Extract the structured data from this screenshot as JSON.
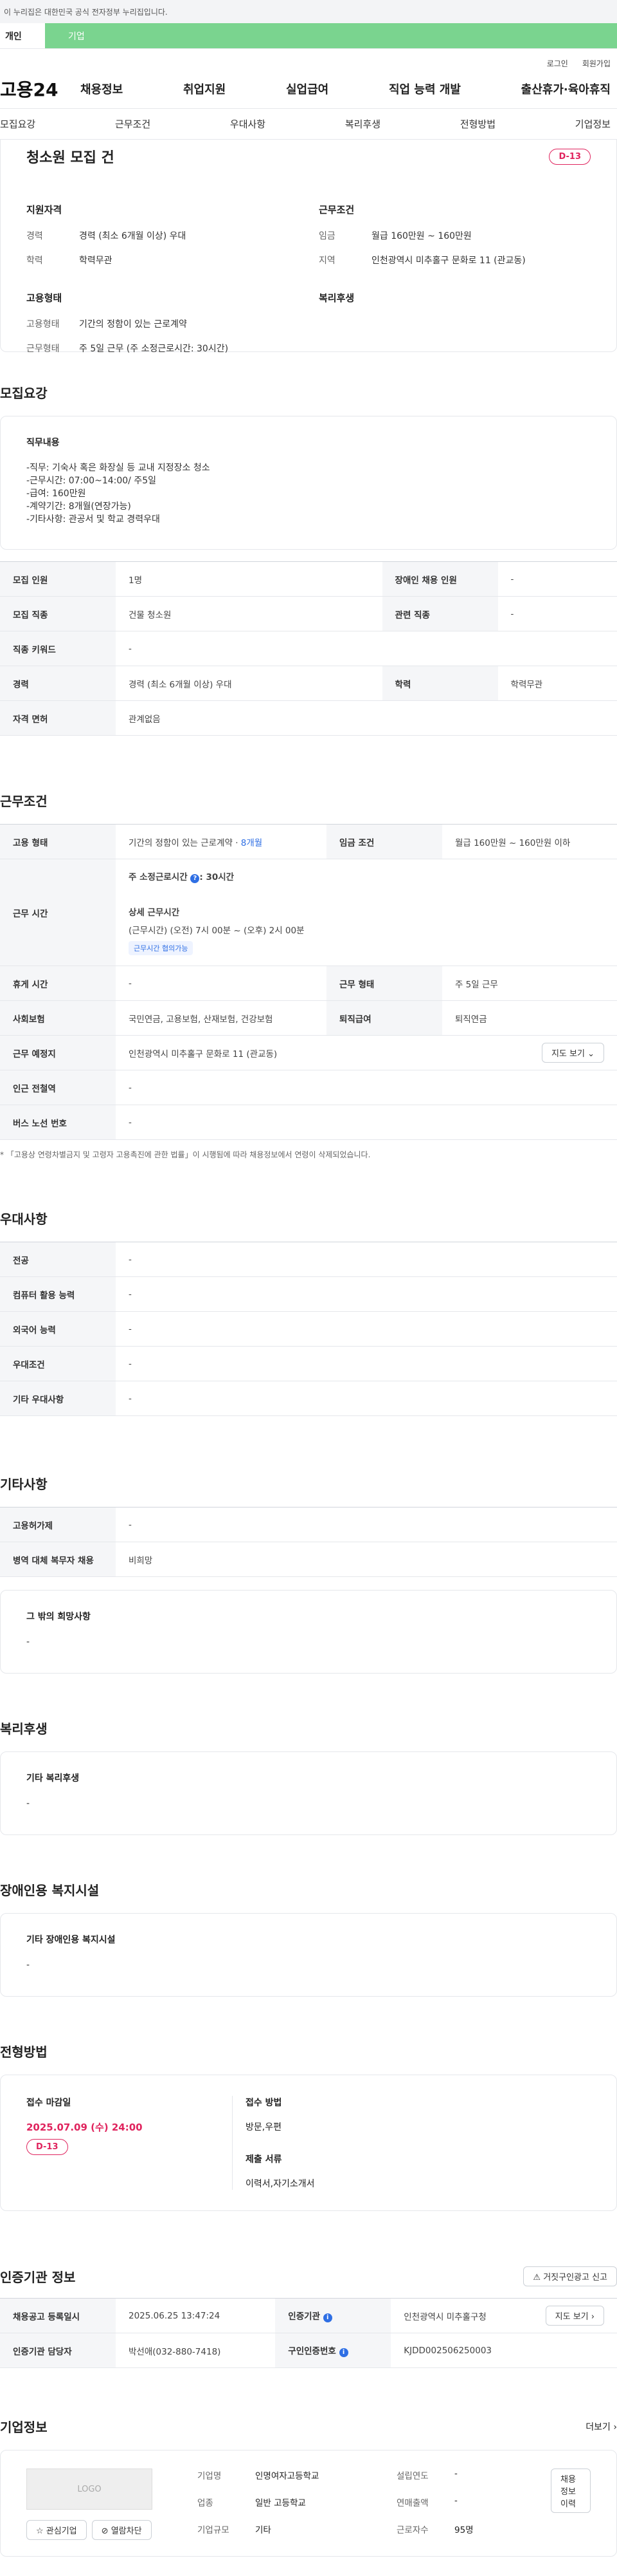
{
  "top_notice": "이 누리집은 대한민국 공식 전자정부 누리집입니다.",
  "role_tabs": [
    "개인",
    "기업"
  ],
  "util": [
    "로그인",
    "회원가입"
  ],
  "logo": "고용24",
  "main_nav": [
    "채용정보",
    "취업지원",
    "실업급여",
    "직업 능력 개발",
    "출산휴가·육아휴직"
  ],
  "sub_nav": [
    "모집요강",
    "근무조건",
    "우대사항",
    "복리후생",
    "전형방법",
    "기업정보"
  ],
  "title_card": {
    "title": "청소원 모집 건",
    "dday": "D-13",
    "qual_heading": "지원자격",
    "qual": [
      {
        "k": "경력",
        "v": "경력 (최소 6개월 이상) 우대"
      },
      {
        "k": "학력",
        "v": "학력무관"
      }
    ],
    "work_heading": "근무조건",
    "work": [
      {
        "k": "임금",
        "v": "월급 160만원 ~ 160만원"
      },
      {
        "k": "지역",
        "v": "인천광역시 미추홀구 문화로 11 (관교동)"
      }
    ],
    "emp_heading": "고용형태",
    "emp": [
      {
        "k": "고용형태",
        "v": "기간의 정함이 있는 근로계약"
      },
      {
        "k": "근무형태",
        "v": "주 5일 근무 (주 소정근로시간: 30시간)"
      }
    ],
    "welfare_heading": "복리후생"
  },
  "recruit": {
    "title": "모집요강",
    "duty_heading": "직무내용",
    "duty_lines": [
      "-직무: 기숙사 혹은 화장실 등 교내 지정장소 청소",
      "-근무시간: 07:00~14:00/ 주5일",
      "-급여: 160만원",
      "-계약기간: 8개월(연장가능)",
      "-기타사항: 관공서 및 학교 경력우대"
    ],
    "rows": [
      [
        "모집 인원",
        "1명",
        "장애인 채용 인원",
        "-"
      ],
      [
        "모집 직종",
        "건물 청소원",
        "관련 직종",
        "-"
      ],
      [
        "직종 키워드",
        "-",
        "",
        ""
      ],
      [
        "경력",
        "경력 (최소 6개월 이상) 우대",
        "학력",
        "학력무관"
      ],
      [
        "자격 면허",
        "관계없음",
        "",
        ""
      ]
    ]
  },
  "conditions": {
    "title": "근무조건",
    "emp_type_k": "고용 형태",
    "emp_type_v": "기간의 정함이 있는 근로계약 · ",
    "emp_type_months": "8개월",
    "wage_k": "임금 조건",
    "wage_v": "월급 160만원 ~ 160만원 이하",
    "hours_k": "근무 시간",
    "hours_weekly": "주 소정근로시간",
    "hours_weekly_help": "?",
    "hours_weekly_v": ": 30시간",
    "hours_detail_h": "상세 근무시간",
    "hours_detail": "(근무시간) (오전) 7시 00분 ~ (오후) 2시 00분",
    "hours_tag": "근무시간 협의가능",
    "rest_k": "휴게 시간",
    "rest_v": "-",
    "form_k": "근무 형태",
    "form_v": "주 5일 근무",
    "ins_k": "사회보험",
    "ins_v": "국민연금, 고용보험, 산재보험, 건강보험",
    "sev_k": "퇴직급여",
    "sev_v": "퇴직연금",
    "place_k": "근무 예정지",
    "place_v": "인천광역시 미추홀구 문화로 11 (관교동)",
    "map_btn": "지도 보기",
    "station_k": "인근 전철역",
    "station_v": "-",
    "bus_k": "버스 노선 번호",
    "bus_v": "-",
    "note": "* 「고용상 연령차별금지 및 고령자 고용촉진에 관한 법률」이 시행됨에 따라 채용정보에서 연령이 삭제되었습니다."
  },
  "prefer": {
    "title": "우대사항",
    "rows": [
      [
        "전공",
        "-"
      ],
      [
        "컴퓨터 활용 능력",
        "-"
      ],
      [
        "외국어 능력",
        "-"
      ],
      [
        "우대조건",
        "-"
      ],
      [
        "기타 우대사항",
        "-"
      ]
    ]
  },
  "etc": {
    "title": "기타사항",
    "rows": [
      [
        "고용허가제",
        "-"
      ],
      [
        "병역 대체 복무자 채용",
        "비희망"
      ]
    ],
    "box_heading": "그 밖의 희망사항",
    "box_value": "-"
  },
  "welfare": {
    "title": "복리후생",
    "heading": "기타 복리후생",
    "value": "-"
  },
  "disabled": {
    "title": "장애인용 복지시설",
    "heading": "기타 장애인용 복지시설",
    "value": "-"
  },
  "process": {
    "title": "전형방법",
    "deadline_h": "접수 마감일",
    "deadline": "2025.07.09 (수) 24:00",
    "dday": "D-13",
    "method_h": "접수 방법",
    "method": "방문,우편",
    "docs_h": "제출 서류",
    "docs": "이력서,자기소개서"
  },
  "cert": {
    "title": "인증기관 정보",
    "report_btn": "거짓구인광고 신고",
    "rows": [
      [
        "채용공고 등록일시",
        "2025.06.25 13:47:24",
        "인증기관",
        "인천광역시 미추홀구청"
      ],
      [
        "인증기관 담당자",
        "박선애(032-880-7418)",
        "구인인증번호",
        "KJDD002506250003"
      ]
    ],
    "detail_btn": "지도 보기"
  },
  "company": {
    "title": "기업정보",
    "more": "더보기",
    "logo_text": "LOGO",
    "interest_btn": "관심기업",
    "block_btn": "열람차단",
    "history_btn": "채용정보 이력",
    "rows": [
      [
        "기업명",
        "인명여자고등학교",
        "설립연도",
        "-"
      ],
      [
        "업종",
        "일반 고등학교",
        "연매출액",
        "-"
      ],
      [
        "기업규모",
        "기타",
        "근로자수",
        "95명"
      ]
    ]
  }
}
